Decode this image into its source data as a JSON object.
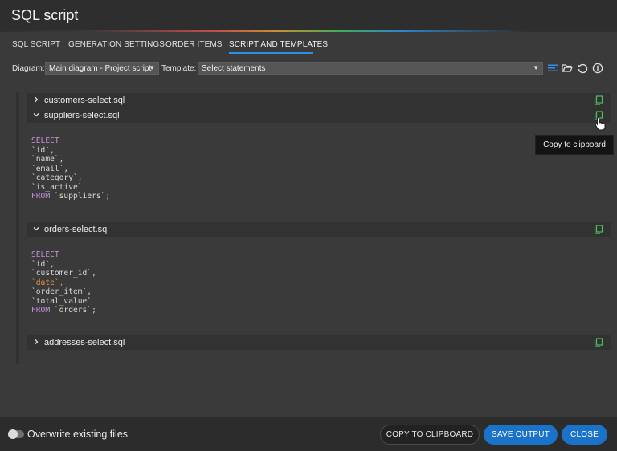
{
  "window": {
    "title": "SQL script"
  },
  "tabs": [
    {
      "label": "SQL SCRIPT"
    },
    {
      "label": "GENERATION SETTINGS"
    },
    {
      "label": "ORDER ITEMS"
    },
    {
      "label": "SCRIPT AND TEMPLATES",
      "active": true
    }
  ],
  "toolbar": {
    "diagram_label": "Diagram:",
    "diagram_value": "Main diagram - Project script",
    "template_label": "Template:",
    "template_value": "Select statements",
    "icons": [
      "format-lines-icon",
      "folder-open-icon",
      "reset-icon",
      "info-icon"
    ]
  },
  "files": [
    {
      "name": "customers-select.sql",
      "expanded": false
    },
    {
      "name": "suppliers-select.sql",
      "expanded": true,
      "code": [
        "SELECT",
        "`id`,",
        "`name`,",
        "`email`,",
        "`category`,",
        "`is_active`",
        "FROM `suppliers`;"
      ]
    },
    {
      "name": "orders-select.sql",
      "expanded": true,
      "code": [
        "SELECT",
        "`id`,",
        "`customer_id`,",
        "`date`,",
        "`order_item`,",
        "`total_value`",
        "FROM `orders`;"
      ]
    },
    {
      "name": "addresses-select.sql",
      "expanded": false
    }
  ],
  "code_tokens": {
    "keyword_select": "SELECT",
    "keyword_from": "FROM"
  },
  "tooltip": {
    "text": "Copy to clipboard"
  },
  "footer": {
    "overwrite_label": "Overwrite existing files",
    "overwrite_on": false,
    "copy_label": "COPY TO CLIPBOARD",
    "save_label": "SAVE OUTPUT",
    "close_label": "CLOSE"
  },
  "colors": {
    "accent": "#1a73c9",
    "tab_underline": "#2f8fe6",
    "keyword": "#c690d8",
    "highlight": "#e0944e"
  }
}
